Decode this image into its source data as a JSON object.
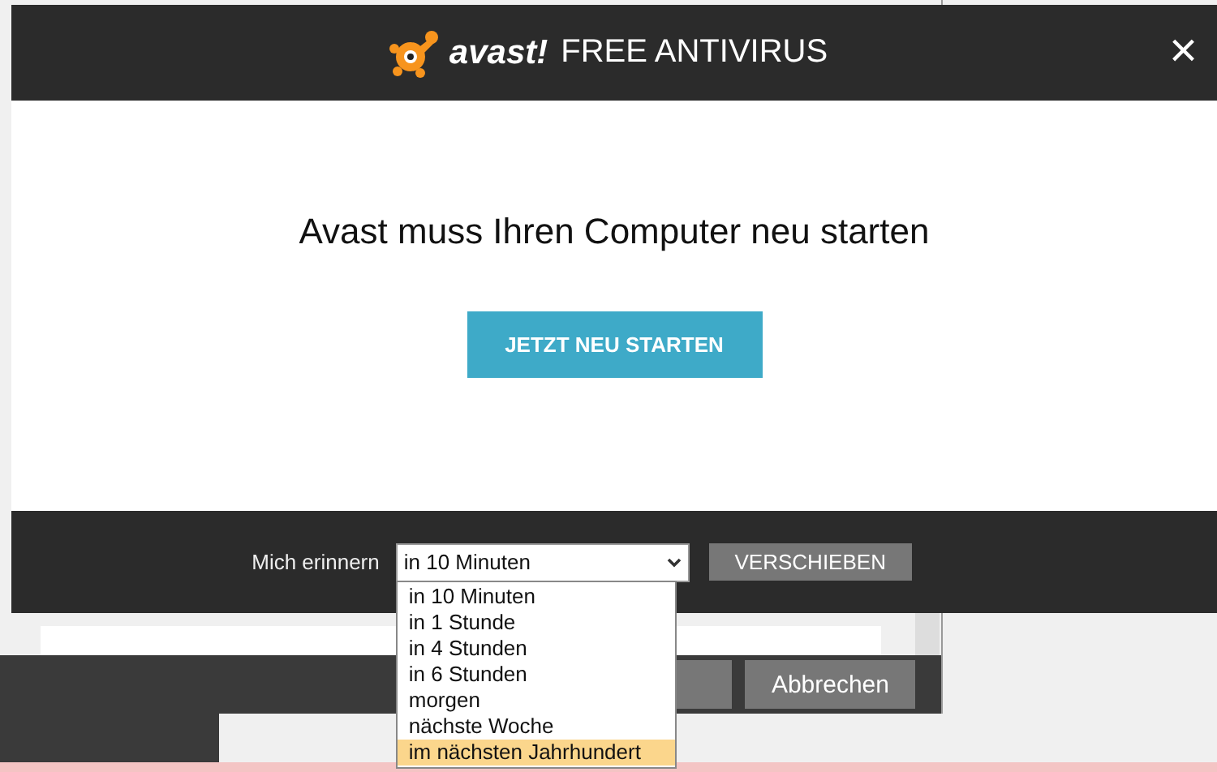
{
  "dialog": {
    "logo_text": "avast!",
    "title": "FREE ANTIVIRUS",
    "close": "×",
    "message": "Avast muss Ihren Computer neu starten",
    "restart_button": "JETZT NEU STARTEN",
    "remind_label": "Mich erinnern",
    "remind_value": "in 10 Minuten",
    "postpone_button": "VERSCHIEBEN"
  },
  "dropdown": {
    "options": [
      {
        "label": "in 10 Minuten",
        "selected": false
      },
      {
        "label": "in 1 Stunde",
        "selected": false
      },
      {
        "label": "in 4 Stunden",
        "selected": false
      },
      {
        "label": "in 6 Stunden",
        "selected": false
      },
      {
        "label": "morgen",
        "selected": false
      },
      {
        "label": "nächste Woche",
        "selected": false
      },
      {
        "label": "im nächsten Jahrhundert",
        "selected": true
      }
    ]
  },
  "background_window": {
    "cancel_button": "Abbrechen"
  }
}
